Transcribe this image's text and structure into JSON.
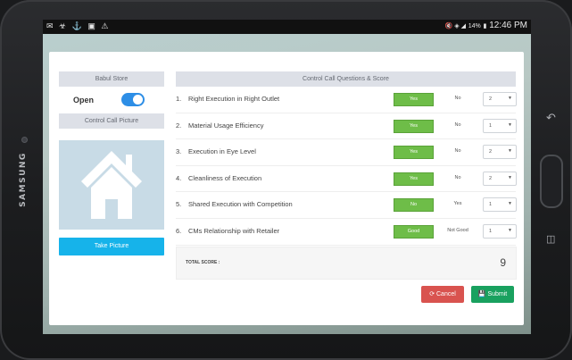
{
  "device": {
    "brand": "SAMSUNG"
  },
  "status_bar": {
    "left_icons": [
      "mail-icon",
      "usb-icon",
      "download-icon",
      "image-icon",
      "warning-icon"
    ],
    "battery": "14%",
    "time": "12:46 PM"
  },
  "store": {
    "name": "Babul Store",
    "open_label": "Open",
    "open": true
  },
  "picture": {
    "header": "Control Call Picture",
    "take_label": "Take Picture"
  },
  "questions": {
    "header": "Control Call Questions & Score",
    "items": [
      {
        "num": "1.",
        "text": "Right Execution in Right Outlet",
        "yes": "Yes",
        "no": "No",
        "score": "2"
      },
      {
        "num": "2.",
        "text": "Material Usage Efficiency",
        "yes": "Yes",
        "no": "No",
        "score": "1"
      },
      {
        "num": "3.",
        "text": "Execution in Eye Level",
        "yes": "Yes",
        "no": "No",
        "score": "2"
      },
      {
        "num": "4.",
        "text": "Cleanliness of Execution",
        "yes": "Yes",
        "no": "No",
        "score": "2"
      },
      {
        "num": "5.",
        "text": "Shared Execution with Competition",
        "yes": "No",
        "no": "Yes",
        "score": "1"
      },
      {
        "num": "6.",
        "text": "CMs Relationship with Retailer",
        "yes": "Good",
        "no": "Not Good",
        "score": "1"
      }
    ]
  },
  "total": {
    "label": "TOTAL SCORE :",
    "value": "9"
  },
  "actions": {
    "cancel": "Cancel",
    "submit": "Submit"
  },
  "colors": {
    "primary": "#2d8ee6",
    "accent_blue": "#16b3ea",
    "selected_green": "#6ebd48",
    "cancel": "#d9534f",
    "submit": "#19a15f"
  }
}
